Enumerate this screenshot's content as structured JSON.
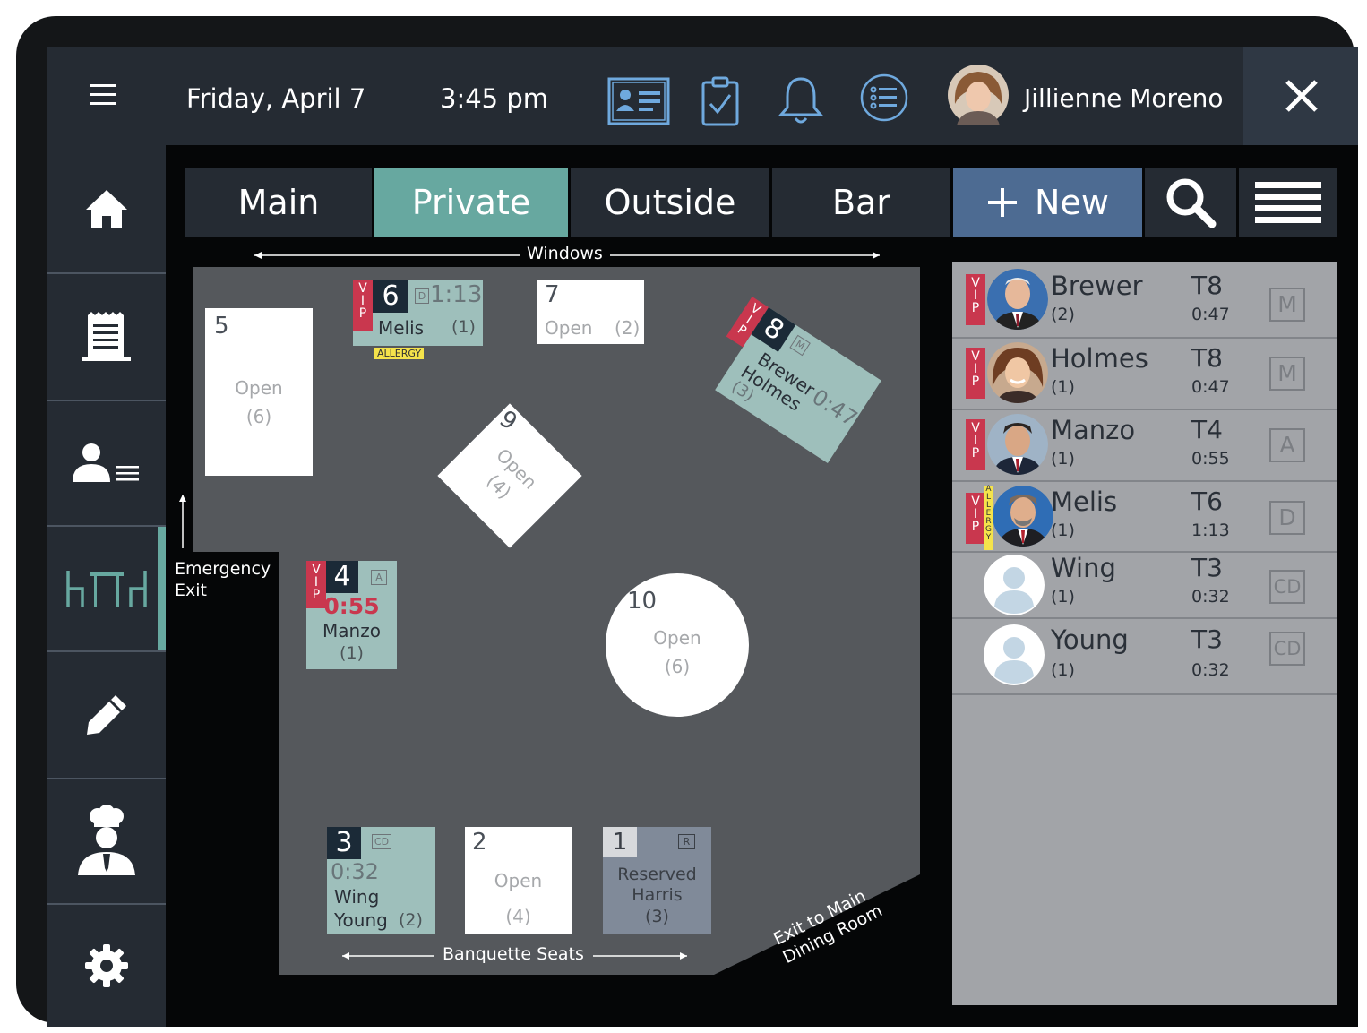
{
  "header": {
    "date": "Friday, April 7",
    "time": "3:45 pm",
    "user_name": "Jillienne Moreno",
    "icons": [
      "menu-icon",
      "id-card-icon",
      "clipboard-check-icon",
      "bell-icon",
      "list-icon",
      "close-icon"
    ]
  },
  "sidebar": {
    "items": [
      "home-icon",
      "receipt-icon",
      "guest-list-icon",
      "tables-icon",
      "edit-icon",
      "chef-icon",
      "settings-icon"
    ],
    "active": "tables-icon"
  },
  "tabs": {
    "main": "Main",
    "private": "Private",
    "outside": "Outside",
    "bar": "Bar",
    "new": "New",
    "active": "Private"
  },
  "floor": {
    "windows_label": "Windows",
    "emergency_label": "Emergency\nExit",
    "banquette_label": "Banquette Seats",
    "exit_main_label": "Exit to Main\nDining Room",
    "allergy_label": "ALLERGY",
    "vip_label": "VIP",
    "tables": {
      "t1": {
        "num": "1",
        "badge": "R",
        "line1": "Reserved",
        "line2": "Harris",
        "party": "(3)"
      },
      "t2": {
        "num": "2",
        "status": "Open",
        "party": "(4)"
      },
      "t3": {
        "num": "3",
        "badge": "CD",
        "time": "0:32",
        "guest1": "Wing",
        "guest2": "Young",
        "party": "(2)"
      },
      "t4": {
        "num": "4",
        "badge": "A",
        "time": "0:55",
        "guest": "Manzo",
        "party": "(1)"
      },
      "t5": {
        "num": "5",
        "status": "Open",
        "party": "(6)"
      },
      "t6": {
        "num": "6",
        "badge": "D",
        "time": "1:13",
        "guest": "Melis",
        "party": "(1)"
      },
      "t7": {
        "num": "7",
        "status": "Open",
        "party": "(2)"
      },
      "t8": {
        "num": "8",
        "badge": "M",
        "time": "0:47",
        "guest1": "Brewer",
        "guest2": "Holmes",
        "party": "(3)"
      },
      "t9": {
        "num": "9",
        "status": "Open",
        "party": "(4)"
      },
      "t10": {
        "num": "10",
        "status": "Open",
        "party": "(6)"
      }
    }
  },
  "guests": [
    {
      "name": "Brewer",
      "party": "(2)",
      "table": "T8",
      "time": "0:47",
      "server": "M",
      "vip": true,
      "allergy": false
    },
    {
      "name": "Holmes",
      "party": "(1)",
      "table": "T8",
      "time": "0:47",
      "server": "M",
      "vip": true,
      "allergy": false
    },
    {
      "name": "Manzo",
      "party": "(1)",
      "table": "T4",
      "time": "0:55",
      "server": "A",
      "vip": true,
      "allergy": false
    },
    {
      "name": "Melis",
      "party": "(1)",
      "table": "T6",
      "time": "1:13",
      "server": "D",
      "vip": true,
      "allergy": true
    },
    {
      "name": "Wing",
      "party": "(1)",
      "table": "T3",
      "time": "0:32",
      "server": "CD",
      "vip": false,
      "allergy": false
    },
    {
      "name": "Young",
      "party": "(1)",
      "table": "T3",
      "time": "0:32",
      "server": "CD",
      "vip": false,
      "allergy": false
    }
  ],
  "colors": {
    "bar": "#252b33",
    "accent_teal": "#67a8a0",
    "occupied": "#9ebfbb",
    "reserved": "#808a99",
    "vip_red": "#c9374e",
    "allergy_yellow": "#f5e34b",
    "new_button": "#4d6b92",
    "floor": "#55585c",
    "panel": "#a2a4a8"
  }
}
